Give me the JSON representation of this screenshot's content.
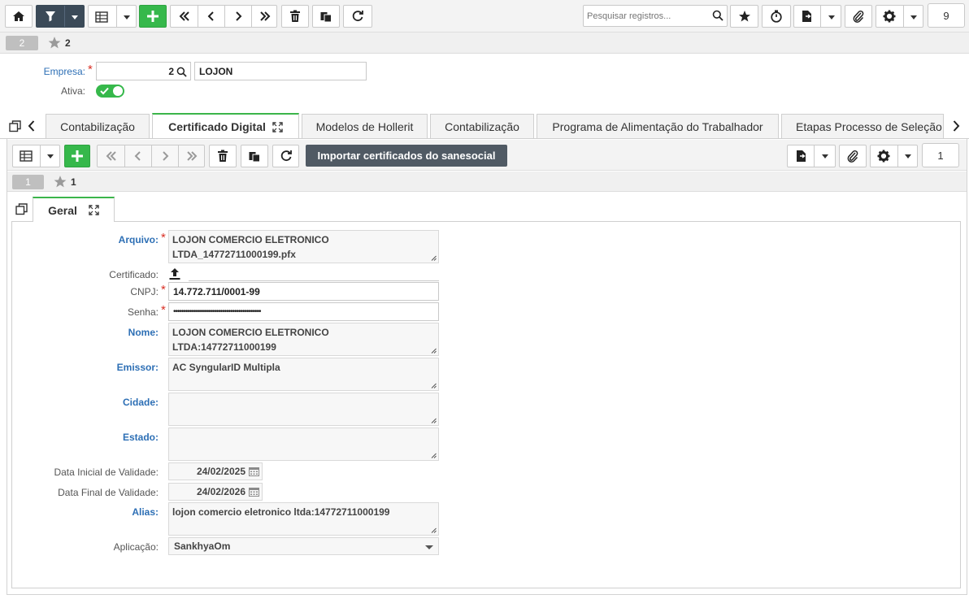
{
  "toolbar": {
    "search_placeholder": "Pesquisar registros...",
    "page": "9"
  },
  "record_bar": {
    "current": "2",
    "count": "2"
  },
  "header_form": {
    "empresa_label": "Empresa:",
    "empresa_code": "2",
    "empresa_name": "LOJON",
    "ativa_label": "Ativa:",
    "ativa_on": true
  },
  "tabs": [
    {
      "label": "Contabilização"
    },
    {
      "label": "Certificado Digital"
    },
    {
      "label": "Modelos de Hollerit"
    },
    {
      "label": "Contabilização"
    },
    {
      "label": "Programa de Alimentação do Trabalhador"
    },
    {
      "label": "Etapas Processo de Seleção"
    }
  ],
  "subtoolbar": {
    "import_label": "Importar certificados do sanesocial",
    "page": "1"
  },
  "sub_record_bar": {
    "current": "1",
    "count": "1"
  },
  "inner_tab": {
    "label": "Geral"
  },
  "form": {
    "arquivo_label": "Arquivo:",
    "arquivo_value": "LOJON COMERCIO ELETRONICO LTDA_14772711000199.pfx",
    "certificado_label": "Certificado:",
    "cnpj_label": "CNPJ:",
    "cnpj_value": "14.772.711/0001-99",
    "senha_label": "Senha:",
    "senha_value": "•••••••••••••••••••••••••••••••••••••••••••",
    "nome_label": "Nome:",
    "nome_value": "LOJON COMERCIO ELETRONICO LTDA:14772711000199",
    "emissor_label": "Emissor:",
    "emissor_value": "AC SyngularID Multipla",
    "cidade_label": "Cidade:",
    "cidade_value": "",
    "estado_label": "Estado:",
    "estado_value": "",
    "data_inicial_label": "Data Inicial de Validade:",
    "data_inicial_value": "24/02/2025",
    "data_final_label": "Data Final de Validade:",
    "data_final_value": "24/02/2026",
    "alias_label": "Alias:",
    "alias_value": "lojon comercio eletronico ltda:14772711000199",
    "aplicacao_label": "Aplicação:",
    "aplicacao_value": "SankhyaOm"
  },
  "colors": {
    "accent_green": "#36b84b",
    "dark_button": "#3b4a58",
    "label_blue": "#2d6fb5",
    "required_red": "#d93025"
  }
}
